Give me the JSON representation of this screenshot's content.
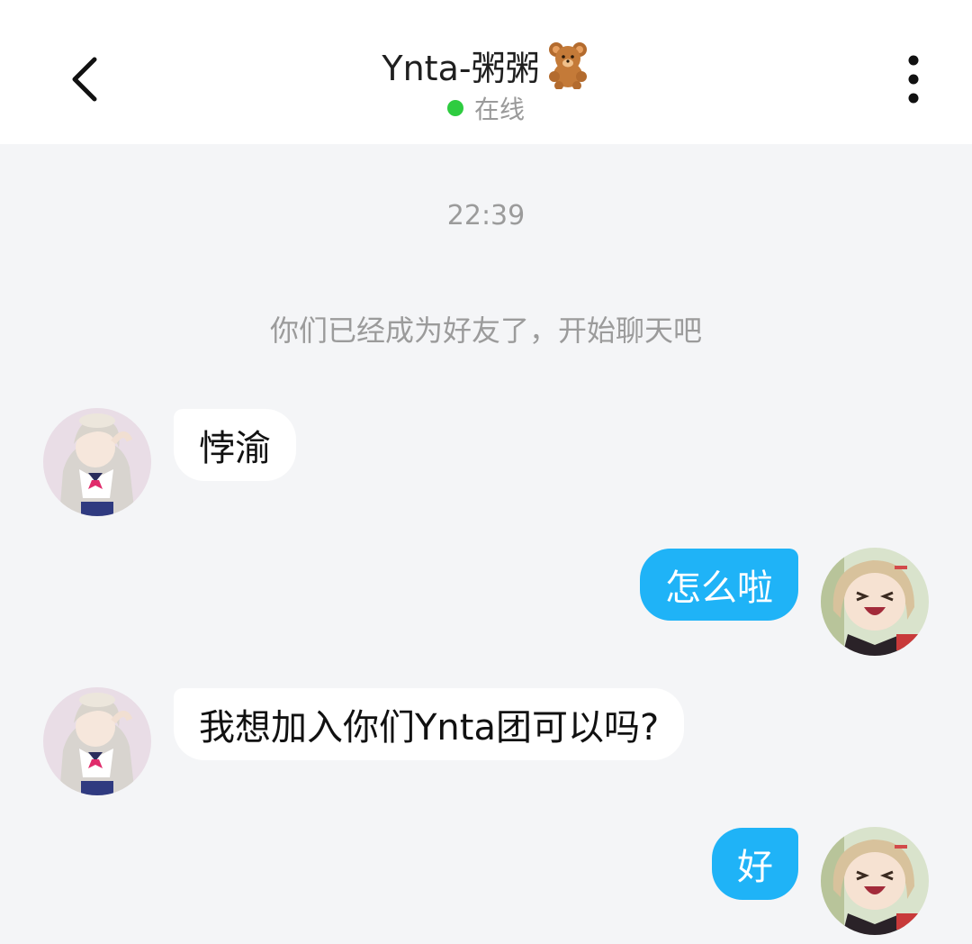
{
  "header": {
    "back_icon": "chevron-left-icon",
    "title": "Ynta-粥粥",
    "title_emoji": "teddy-bear-icon",
    "status": "在线",
    "status_color": "#2ecc40",
    "more_icon": "more-vertical-icon"
  },
  "conversation": {
    "timestamp": "22:39",
    "system_message": "你们已经成为好友了，开始聊天吧",
    "messages": [
      {
        "side": "left",
        "text": "悖渝"
      },
      {
        "side": "right",
        "text": "怎么啦"
      },
      {
        "side": "left",
        "text": "我想加入你们Ynta团可以吗?"
      },
      {
        "side": "right",
        "text": "好"
      }
    ]
  },
  "colors": {
    "background": "#f4f5f7",
    "outgoing_bubble": "#1fb3f7",
    "incoming_bubble": "#ffffff"
  }
}
